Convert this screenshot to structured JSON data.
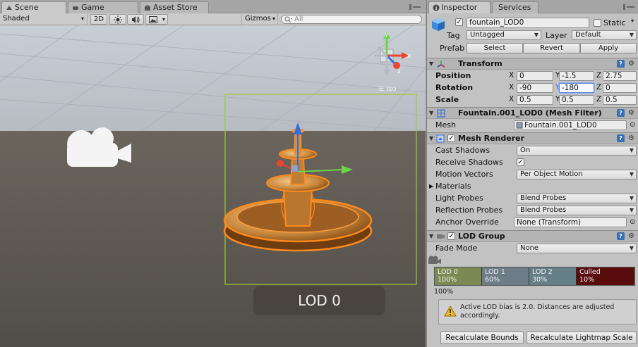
{
  "scene": {
    "tabs": [
      {
        "label": "Scene",
        "icon": "scene-icon"
      },
      {
        "label": "Game",
        "icon": "game-icon"
      },
      {
        "label": "Asset Store",
        "icon": "asset-store-icon"
      }
    ],
    "toolbar": {
      "shading_mode": "Shaded",
      "mode_2d": "2D",
      "gizmos": "Gizmos",
      "search_placeholder": "All"
    },
    "persp_label": "Iso",
    "lod_overlay": "LOD 0"
  },
  "inspector": {
    "tabs": [
      {
        "label": "Inspector"
      },
      {
        "label": "Services"
      }
    ],
    "header": {
      "name": "fountain_LOD0",
      "static_label": "Static",
      "tag_label": "Tag",
      "tag_value": "Untagged",
      "layer_label": "Layer",
      "layer_value": "Default",
      "prefab_label": "Prefab",
      "prefab_buttons": [
        "Select",
        "Revert",
        "Apply"
      ]
    },
    "transform": {
      "title": "Transform",
      "rows": [
        {
          "label": "Position",
          "x": "0",
          "y": "-1.5",
          "z": "2.75"
        },
        {
          "label": "Rotation",
          "x": "-90",
          "y": "-180",
          "z": "0"
        },
        {
          "label": "Scale",
          "x": "0.5",
          "y": "0.5",
          "z": "0.5"
        }
      ],
      "axes": [
        "X",
        "Y",
        "Z"
      ]
    },
    "mesh_filter": {
      "title": "Fountain.001_LOD0 (Mesh Filter)",
      "mesh_label": "Mesh",
      "mesh_value": "Fountain.001_LOD0"
    },
    "mesh_renderer": {
      "title": "Mesh Renderer",
      "cast_shadows_label": "Cast Shadows",
      "cast_shadows_value": "On",
      "receive_shadows_label": "Receive Shadows",
      "motion_vectors_label": "Motion Vectors",
      "motion_vectors_value": "Per Object Motion",
      "materials_label": "Materials",
      "light_probes_label": "Light Probes",
      "light_probes_value": "Blend Probes",
      "reflection_probes_label": "Reflection Probes",
      "reflection_probes_value": "Blend Probes",
      "anchor_override_label": "Anchor Override",
      "anchor_override_value": "None (Transform)"
    },
    "lod_group": {
      "title": "LOD Group",
      "fade_mode_label": "Fade Mode",
      "fade_mode_value": "None",
      "levels": [
        {
          "name": "LOD 0",
          "percent": "100%",
          "color": "#7b8a54",
          "share": 0.235
        },
        {
          "name": "LOD 1",
          "percent": "60%",
          "color": "#6d7c86",
          "share": 0.235
        },
        {
          "name": "LOD 2",
          "percent": "30%",
          "color": "#657f87",
          "share": 0.235
        },
        {
          "name": "Culled",
          "percent": "10%",
          "color": "#5a0b0b",
          "share": 0.295
        }
      ],
      "slider_label": "100%",
      "warning": "Active LOD bias is 2.0. Distances are adjusted accordingly.",
      "recalc_bounds": "Recalculate Bounds",
      "recalc_lightmap": "Recalculate Lightmap Scale"
    }
  },
  "colors": {
    "selection_orange": "#ff8a1c",
    "bounds_green": "#9acd32",
    "sky": "#bfc8d4",
    "ground": "#5c5851"
  }
}
